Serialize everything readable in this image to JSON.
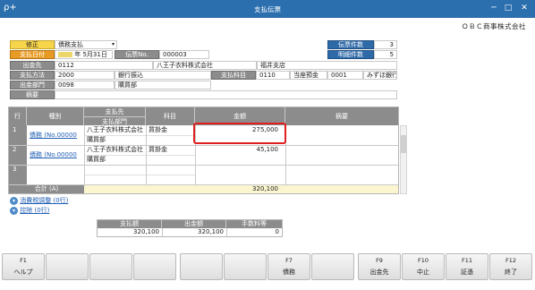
{
  "window": {
    "title": "支払伝票",
    "app_icon": "ρ+",
    "ctrl_min": "─",
    "ctrl_max": "□",
    "ctrl_close": "✕"
  },
  "company": "ＯＢＣ商事株式会社",
  "header": {
    "correction_label": "修正",
    "correction_value": "債務支払",
    "payment_date_label": "支払日付",
    "payment_date_era": "",
    "payment_date_value": "年 5月31日",
    "slip_no_label": "伝票No.",
    "slip_no_value": "000003",
    "slip_count_label": "伝票件数",
    "slip_count_value": "3",
    "detail_count_label": "明細件数",
    "detail_count_value": "5",
    "payee_label": "出金先",
    "payee_code": "0112",
    "payee_name": "八王子衣料株式会社",
    "payee_branch": "福井支店",
    "method_label": "支払方法",
    "method_code": "2000",
    "method_name": "銀行振込",
    "account_label": "支払科目",
    "account_code": "0110",
    "account_name": "当座預金",
    "bank_code": "0001",
    "bank_name": "みずほ銀行",
    "dept_label": "出金部門",
    "dept_code": "0098",
    "dept_name": "購買部",
    "memo_label": "摘要",
    "memo_value": ""
  },
  "grid": {
    "col_row": "行",
    "col_type": "種別",
    "col_payee": "支払先",
    "col_dept": "支払部門",
    "col_account": "科目",
    "col_amount": "金額",
    "col_memo": "摘要",
    "rows": [
      {
        "num": "1",
        "type": "債務 (No.00000",
        "payee": "八王子衣料株式会社",
        "dept": "購買部",
        "account": "買掛金",
        "amount": "275,000",
        "memo": ""
      },
      {
        "num": "2",
        "type": "債務 (No.00000",
        "payee": "八王子衣料株式会社",
        "dept": "購買部",
        "account": "買掛金",
        "amount": "45,100",
        "memo": ""
      },
      {
        "num": "3",
        "type": "",
        "payee": "",
        "dept": "",
        "account": "",
        "amount": "",
        "memo": ""
      }
    ],
    "total_label": "合計 (A)",
    "total_amount": "320,100"
  },
  "links": {
    "tax_adjust": "消費税調整 (0行)",
    "deduction": "控除 (0行)"
  },
  "summary": {
    "h_payment": "支払額",
    "h_outflow": "出金額",
    "h_fee": "手数料等",
    "payment": "320,100",
    "outflow": "320,100",
    "fee": "0"
  },
  "fkeys": [
    {
      "num": "F1",
      "label": "ヘルプ"
    },
    {
      "num": "",
      "label": ""
    },
    {
      "num": "",
      "label": ""
    },
    {
      "num": "",
      "label": ""
    },
    {
      "num": "",
      "label": ""
    },
    {
      "num": "",
      "label": ""
    },
    {
      "num": "F7",
      "label": "債務"
    },
    {
      "num": "",
      "label": ""
    },
    {
      "num": "F9",
      "label": "出金先"
    },
    {
      "num": "F10",
      "label": "中止"
    },
    {
      "num": "F11",
      "label": "証憑"
    },
    {
      "num": "F12",
      "label": "終了"
    }
  ],
  "colors": {
    "titlebar": "#2c6fae",
    "label_gray": "#8c8c8c",
    "label_yellow": "#f7d54a",
    "label_orange": "#e79b25",
    "label_blue": "#2f6aa8",
    "highlight_box": "#e02020",
    "link": "#1f5db3"
  }
}
